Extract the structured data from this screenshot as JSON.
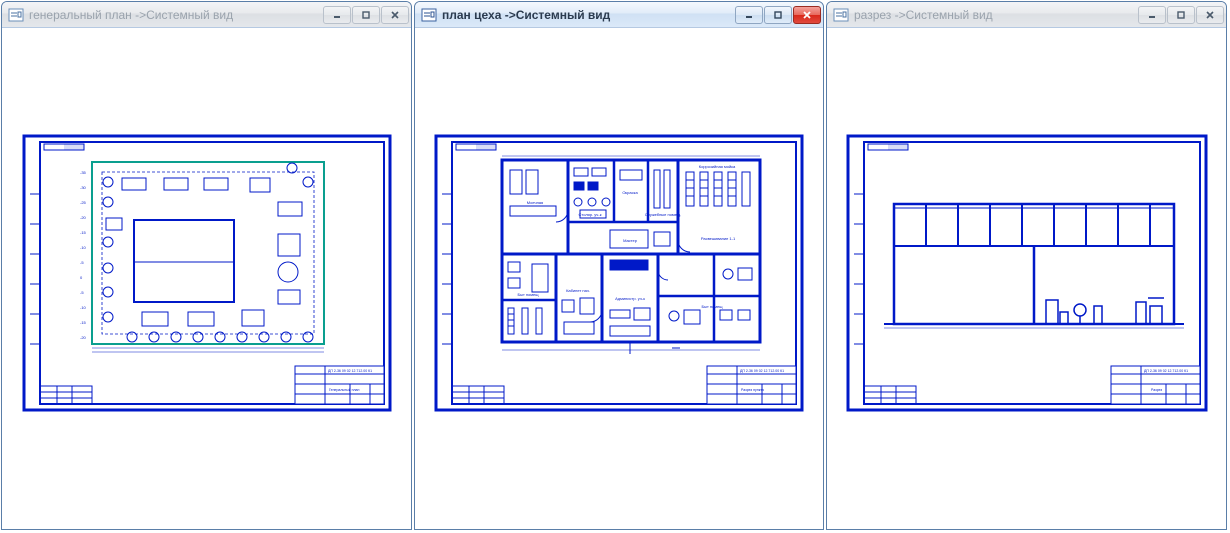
{
  "windows": [
    {
      "id": "win1",
      "title": "генеральный план ->Системный вид",
      "active": false,
      "title_block_label": "Генеральный план",
      "doc_code": "ДП 2-36 09 02 12.712.00 К1"
    },
    {
      "id": "win2",
      "title": "план цеха ->Системный вид",
      "active": true,
      "title_block_label": "Разрез пункта",
      "doc_code": "ДП 2-36 09 02 12.712.00 К1",
      "rooms": {
        "instrumental": "Моечная",
        "savdanya": "Столяр. уч-к",
        "bytovoe": "Окраска",
        "sluzhebnye": "Служебные помещ.",
        "korrosiya": "Коррозийная мойка",
        "masterskaya": "Мастер",
        "remzone": "Расвешивание 1-1",
        "boiler": "Быт помещ",
        "kabinet": "Кабинет нач.",
        "administration": "Администр. уч-к",
        "bytovoe2": "Быт помещ"
      }
    },
    {
      "id": "win3",
      "title": "разрез ->Системный вид",
      "active": false,
      "title_block_label": "Разрез",
      "doc_code": "ДП 2-36 09 02 12.712.00 К1"
    }
  ],
  "controls": {
    "minimize": "minimize",
    "maximize": "maximize",
    "close": "close"
  }
}
